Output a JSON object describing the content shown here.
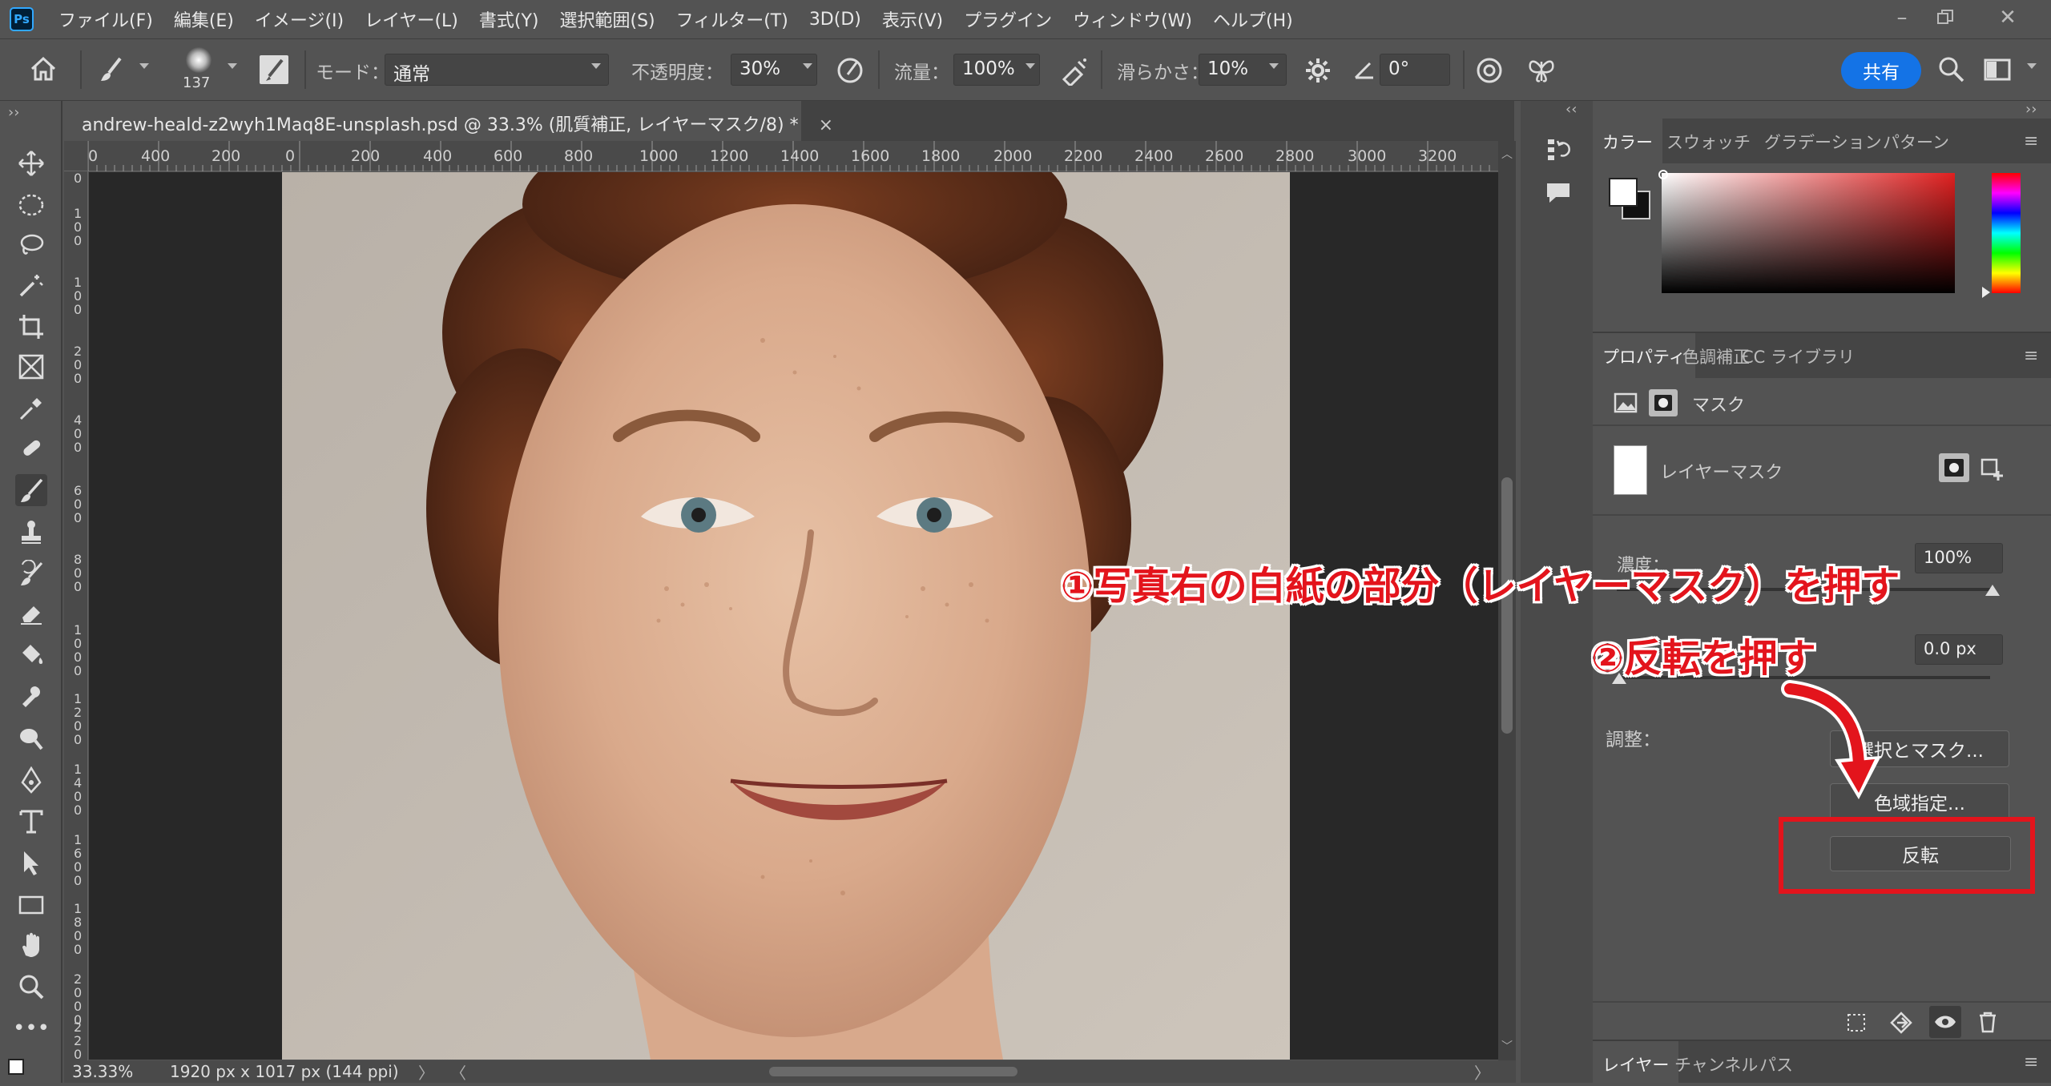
{
  "app": {
    "logo": "Ps"
  },
  "menu": [
    "ファイル(F)",
    "編集(E)",
    "イメージ(I)",
    "レイヤー(L)",
    "書式(Y)",
    "選択範囲(S)",
    "フィルター(T)",
    "3D(D)",
    "表示(V)",
    "プラグイン",
    "ウィンドウ(W)",
    "ヘルプ(H)"
  ],
  "options": {
    "brush_size": "137",
    "mode_label": "モード：",
    "mode_value": "通常",
    "opacity_label": "不透明度：",
    "opacity_value": "30%",
    "flow_label": "流量：",
    "flow_value": "100%",
    "smoothing_label": "滑らかさ：",
    "smoothing_value": "10%",
    "angle_value": "0°",
    "share_label": "共有"
  },
  "document": {
    "tab_title": "andrew-heald-z2wyh1Maq8E-unsplash.psd @ 33.3% (肌質補正, レイヤーマスク/8) *",
    "close": "×"
  },
  "ruler": {
    "h_ticks": [
      "0",
      "400",
      "200",
      "0",
      "200",
      "400",
      "600",
      "800",
      "1000",
      "1200",
      "1400",
      "1600",
      "1800",
      "2000",
      "2200",
      "2400",
      "2600",
      "2800",
      "3000",
      "3200"
    ],
    "v_ticks": [
      "0",
      "100",
      "100",
      "200",
      "400",
      "600",
      "800",
      "1000",
      "1200",
      "1400",
      "1600",
      "1800",
      "2000",
      "2200"
    ]
  },
  "status": {
    "zoom": "33.33%",
    "dimensions": "1920 px x 1017 px (144 ppi)"
  },
  "color_panel": {
    "tabs": [
      "カラー",
      "スウォッチ",
      "グラデーション",
      "パターン"
    ]
  },
  "properties_panel": {
    "tabs": [
      "プロパティ",
      "色調補正",
      "CC ライブラリ"
    ],
    "mask_header": "マスク",
    "layer_mask_label": "レイヤーマスク",
    "density_label": "濃度：",
    "density_value": "100%",
    "feather_value": "0.0 px",
    "adjust_label": "調整：",
    "select_mask_btn": "選択とマスク...",
    "color_range_btn": "色域指定...",
    "invert_btn": "反転"
  },
  "layers_panel": {
    "tabs": [
      "レイヤー",
      "チャンネル",
      "パス"
    ]
  },
  "annotations": {
    "step1": "①写真右の白紙の部分（レイヤーマスク）を押す",
    "step2": "②反転を押す"
  },
  "colors": {
    "annotation_red": "#e3141c",
    "share_blue": "#1473e6"
  }
}
